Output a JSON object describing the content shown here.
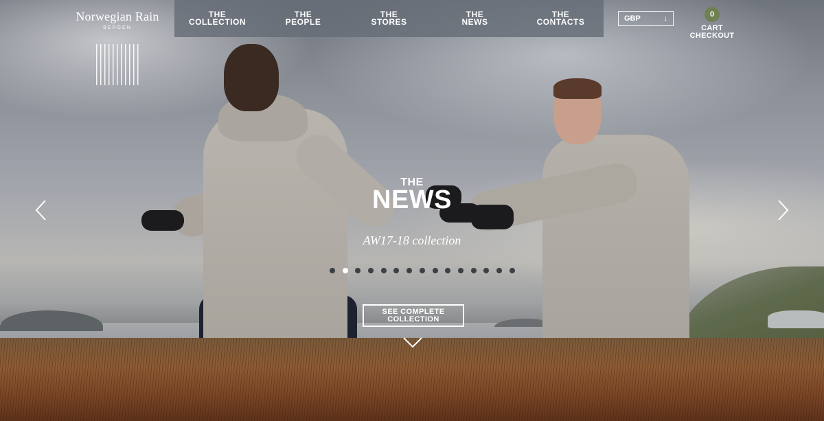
{
  "brand": {
    "name": "Norwegian Rain",
    "city": "BERGEN"
  },
  "nav": {
    "items": [
      {
        "label": "THE\nCOLLECTION"
      },
      {
        "label": "THE\nPEOPLE"
      },
      {
        "label": "THE\nSTORES"
      },
      {
        "label": "THE\nNEWS"
      },
      {
        "label": "THE\nCONTACTS"
      }
    ]
  },
  "currency": {
    "value": "GBP",
    "icon": "arrow-down-icon"
  },
  "cart": {
    "count": "0",
    "label_cart": "CART",
    "label_checkout": "CHECKOUT"
  },
  "hero": {
    "kicker": "THE",
    "title": "NEWS",
    "subtitle": "AW17-18 collection",
    "cta": "SEE COMPLETE\nCOLLECTION",
    "slides_total": 15,
    "active_slide": 2
  },
  "icons": {
    "prev": "chevron-left-icon",
    "next": "chevron-right-icon",
    "scroll": "chevron-down-icon"
  }
}
